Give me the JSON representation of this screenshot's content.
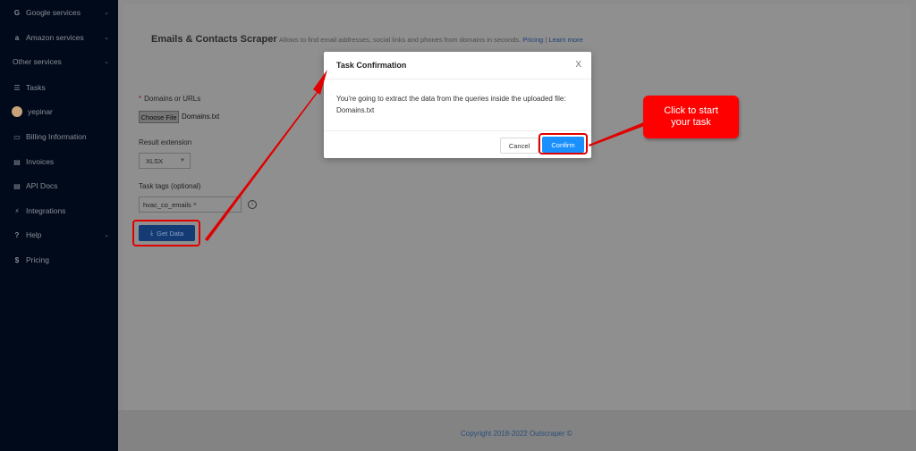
{
  "sidebar": {
    "items": [
      {
        "icon": "G",
        "label": "Google services",
        "chevron": "⌄"
      },
      {
        "icon": "a",
        "label": "Amazon services",
        "chevron": "⌄"
      },
      {
        "icon": "",
        "label": "Other services",
        "chevron": "⌄"
      },
      {
        "icon": "☰",
        "label": "Tasks"
      },
      {
        "icon": "",
        "label": "yepinar"
      },
      {
        "icon": "▭",
        "label": "Billing Information"
      },
      {
        "icon": "▤",
        "label": "Invoices"
      },
      {
        "icon": "▤",
        "label": "API Docs"
      },
      {
        "icon": "⚡",
        "label": "Integrations"
      },
      {
        "icon": "?",
        "label": "Help",
        "chevron": "⌄"
      },
      {
        "icon": "$",
        "label": "Pricing"
      }
    ]
  },
  "page": {
    "title": "Emails & Contacts Scraper",
    "description": "Allows to find email addresses, social links and phones from domains in seconds.",
    "pricing_link": "Pricing",
    "separator": "|",
    "learn_more_link": "Learn more"
  },
  "form": {
    "required_mark": "*",
    "domains_label": "Domains or URLs",
    "choose_file_label": "Choose File",
    "file_name": "Domains.txt",
    "result_extension_label": "Result extension",
    "result_extension_value": "XLSX",
    "task_tags_label": "Task tags (optional)",
    "tag_value": "hvac_co_emails",
    "tag_remove": "×",
    "info_icon": "i",
    "get_data_label": "Get Data",
    "download_icon": "⤓"
  },
  "modal": {
    "title": "Task Confirmation",
    "close": "X",
    "body": "You're going to extract the data from the queries inside the uploaded file:",
    "file_name": "Domains.txt",
    "cancel_label": "Cancel",
    "confirm_label": "Confirm"
  },
  "callout": {
    "line1": "Click to start",
    "line2": "your task",
    "color": "#ff0000"
  },
  "footer": {
    "copyright": "Copyright 2018-2022 Outscraper ©"
  },
  "colors": {
    "sidebar_bg": "#010a1b",
    "confirm_blue": "#1a90ff",
    "highlight_red": "#e00000"
  }
}
